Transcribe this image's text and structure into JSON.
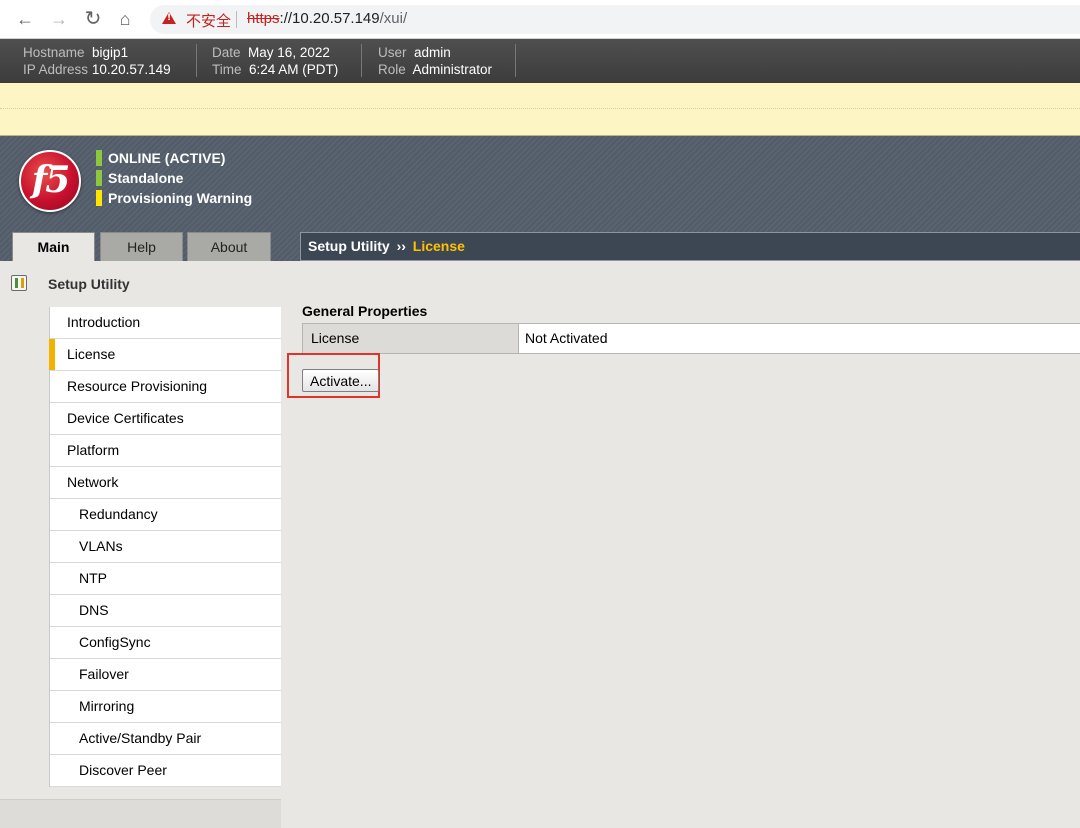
{
  "browser": {
    "insecure_label": "不安全",
    "url_scheme": "https",
    "url_host": "://10.20.57.149",
    "url_path": "/xui/"
  },
  "header": {
    "hostname_label": "Hostname",
    "hostname": "bigip1",
    "ip_label": "IP Address",
    "ip": "10.20.57.149",
    "date_label": "Date",
    "date": "May 16, 2022",
    "time_label": "Time",
    "time": "6:24 AM (PDT)",
    "user_label": "User",
    "user": "admin",
    "role_label": "Role",
    "role": "Administrator"
  },
  "logo_text": "f5",
  "status": [
    {
      "text": "ONLINE (ACTIVE)",
      "color": "#8dc63f"
    },
    {
      "text": "Standalone",
      "color": "#8dc63f"
    },
    {
      "text": "Provisioning Warning",
      "color": "#ffe600"
    }
  ],
  "tabs": {
    "main": "Main",
    "help": "Help",
    "about": "About"
  },
  "breadcrumb": {
    "root": "Setup Utility",
    "sep": "››",
    "current": "License"
  },
  "sidebar": {
    "title": "Setup Utility",
    "items": [
      {
        "label": "Introduction"
      },
      {
        "label": "License"
      },
      {
        "label": "Resource Provisioning"
      },
      {
        "label": "Device Certificates"
      },
      {
        "label": "Platform"
      },
      {
        "label": "Network"
      },
      {
        "label": "Redundancy"
      },
      {
        "label": "VLANs"
      },
      {
        "label": "NTP"
      },
      {
        "label": "DNS"
      },
      {
        "label": "ConfigSync"
      },
      {
        "label": "Failover"
      },
      {
        "label": "Mirroring"
      },
      {
        "label": "Active/Standby Pair"
      },
      {
        "label": "Discover Peer"
      }
    ]
  },
  "content": {
    "section_title": "General Properties",
    "property_name": "License",
    "property_value": "Not Activated",
    "activate_label": "Activate..."
  },
  "colors": {
    "accent_selected": "#f2b300",
    "breadcrumb_current": "#ffc200",
    "highlight_box": "#e0332c",
    "insecure": "#c5221f"
  }
}
